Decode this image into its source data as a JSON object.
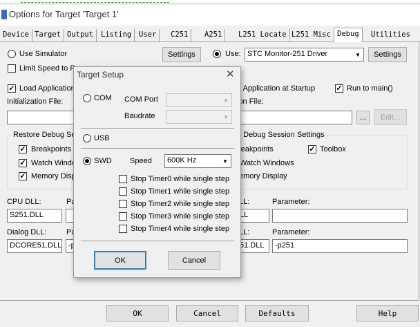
{
  "window": {
    "title": "Options for Target 'Target 1'"
  },
  "tabs": [
    "Device",
    "Target",
    "Output",
    "Listing",
    "User",
    "C251",
    "A251",
    "L251 Locate",
    "L251 Misc",
    "Debug",
    "Utilities"
  ],
  "left": {
    "use_simulator": "Use Simulator",
    "settings": "Settings",
    "limit_speed": "Limit Speed to Re",
    "load_app": "Load Application",
    "init_file": "Initialization File:",
    "restore_group": "Restore Debug Se",
    "breakpoints": "Breakpoints",
    "watch": "Watch Windo",
    "memory": "Memory Disp",
    "cpu_dll": "CPU DLL:",
    "cpu_dll_value": "S251.DLL",
    "param_short": "Pa",
    "dialog_dll": "Dialog DLL:",
    "dialog_dll_value": "DCORE51.DLL",
    "dialog_param_value": "-p"
  },
  "right": {
    "use": "Use:",
    "driver": "STC Monitor-251 Driver",
    "settings": "Settings",
    "load_app": "d Application at Startup",
    "run_main": "Run to main()",
    "init_file": "ion File:",
    "ellipsis": "...",
    "edit": "Edit...",
    "restore_group": "e Debug Session Settings",
    "breakpoints": "reakpoints",
    "toolbox": "Toolbox",
    "watch": "Watch Windows",
    "memory": "emory Display",
    "dll1": "LL:",
    "param1": "Parameter:",
    "dll1_value": "LL",
    "dll2": "LL:",
    "param2": "Parameter:",
    "dll2_value": "51.DLL",
    "param2_value": "-p251"
  },
  "footer": {
    "ok": "OK",
    "cancel": "Cancel",
    "defaults": "Defaults",
    "help": "Help"
  },
  "dialog": {
    "title": "Target Setup",
    "com": "COM",
    "com_port": "COM Port",
    "baudrate": "Baudrate",
    "usb": "USB",
    "swd": "SWD",
    "speed": "Speed",
    "speed_value": "600K Hz",
    "timers": [
      "Stop Timer0 while single step",
      "Stop Timer1 while single step",
      "Stop Timer2 while single step",
      "Stop Timer3 while single step",
      "Stop Timer4 while single step"
    ],
    "ok": "OK",
    "cancel": "Cancel"
  }
}
